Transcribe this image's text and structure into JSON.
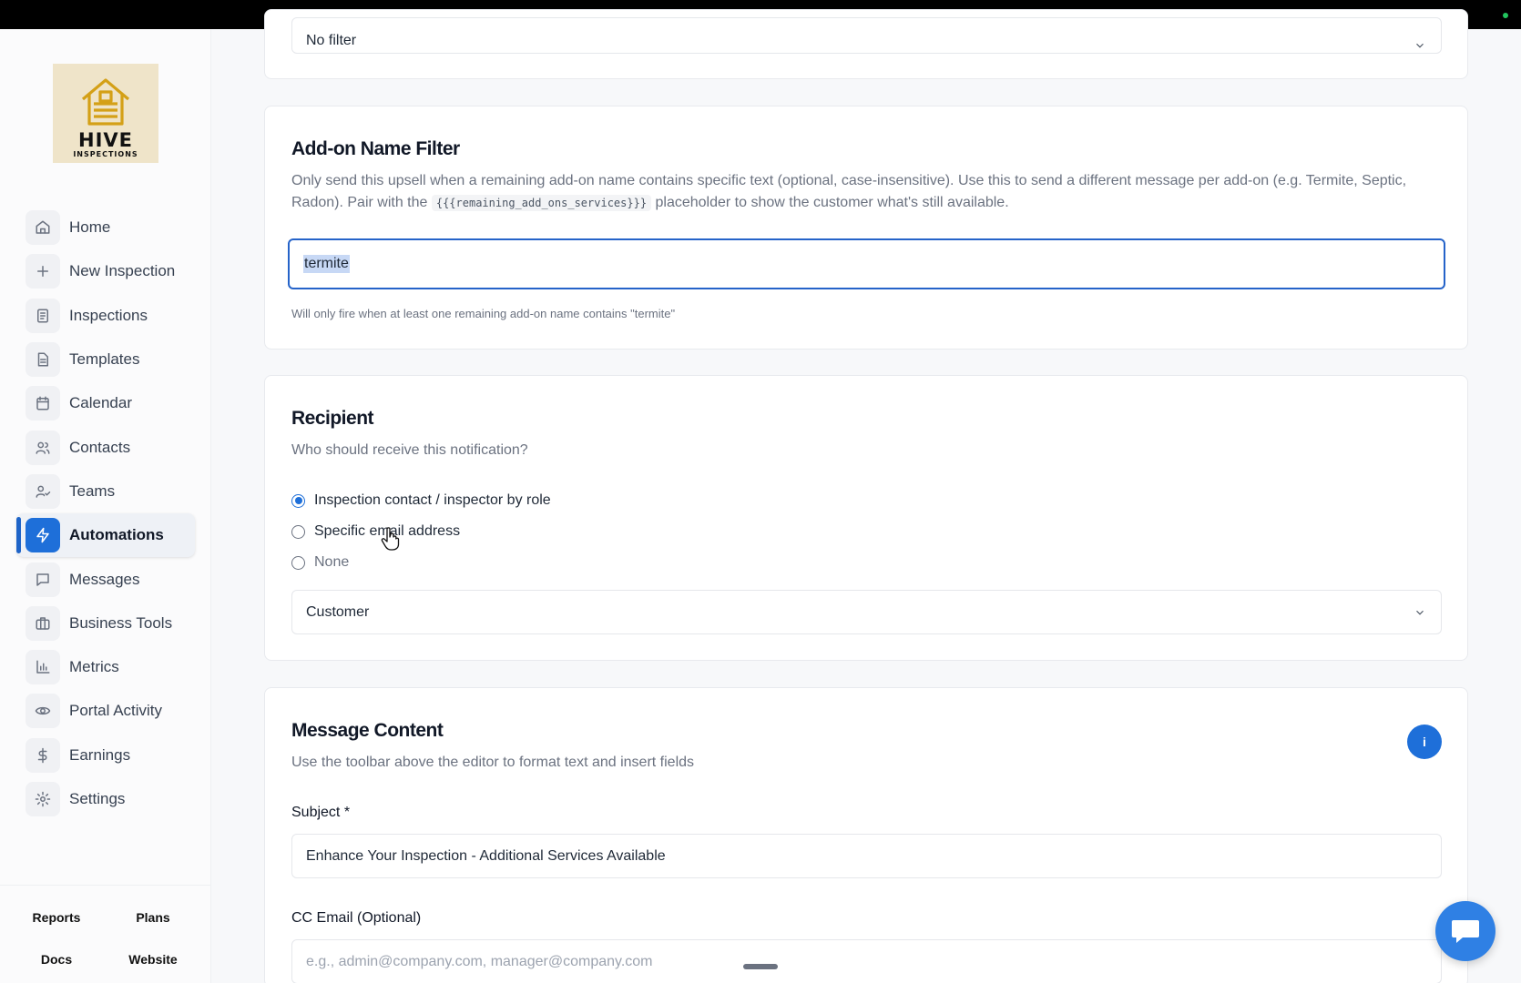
{
  "brand": {
    "line1": "HIVE",
    "line2": "INSPECTIONS"
  },
  "sidebar": {
    "items": [
      {
        "label": "Home",
        "icon": "home-icon"
      },
      {
        "label": "New Inspection",
        "icon": "plus-icon"
      },
      {
        "label": "Inspections",
        "icon": "clipboard-icon"
      },
      {
        "label": "Templates",
        "icon": "document-icon"
      },
      {
        "label": "Calendar",
        "icon": "calendar-icon"
      },
      {
        "label": "Contacts",
        "icon": "users-icon"
      },
      {
        "label": "Teams",
        "icon": "team-icon"
      },
      {
        "label": "Automations",
        "icon": "lightning-icon",
        "active": true
      },
      {
        "label": "Messages",
        "icon": "message-icon"
      },
      {
        "label": "Business Tools",
        "icon": "briefcase-icon"
      },
      {
        "label": "Metrics",
        "icon": "bar-chart-icon"
      },
      {
        "label": "Portal Activity",
        "icon": "eye-icon"
      },
      {
        "label": "Earnings",
        "icon": "dollar-icon"
      },
      {
        "label": "Settings",
        "icon": "gear-icon"
      }
    ],
    "footer": {
      "reports": "Reports",
      "plans": "Plans",
      "docs": "Docs",
      "website": "Website"
    }
  },
  "top_card": {
    "select_value": "No filter"
  },
  "addon_filter": {
    "title": "Add-on Name Filter",
    "desc_part1": "Only send this upsell when a remaining add-on name contains specific text (optional, case-insensitive). Use this to send a different message per add-on (e.g. Termite, Septic, Radon). Pair with the",
    "desc_code": "{{{remaining_add_ons_services}}}",
    "desc_part2": "placeholder to show the customer what's still available.",
    "input_value": "termite",
    "hint": "Will only fire when at least one remaining add-on name contains \"termite\""
  },
  "recipient": {
    "title": "Recipient",
    "desc": "Who should receive this notification?",
    "options": [
      {
        "label": "Inspection contact / inspector by role",
        "selected": true
      },
      {
        "label": "Specific email address",
        "selected": false
      },
      {
        "label": "None",
        "selected": false
      }
    ],
    "role_select": "Customer"
  },
  "message": {
    "title": "Message Content",
    "desc": "Use the toolbar above the editor to format text and insert fields",
    "info_label": "i",
    "subject_label": "Subject *",
    "subject_value": "Enhance Your Inspection - Additional Services Available",
    "cc_label": "CC Email (Optional)",
    "cc_placeholder": "e.g., admin@company.com, manager@company.com"
  },
  "colors": {
    "accent": "#1e6fd9",
    "chat": "#2f80e4"
  }
}
